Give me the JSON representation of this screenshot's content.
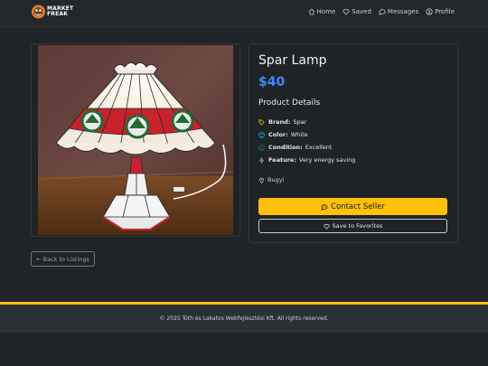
{
  "nav": {
    "logo_text": "MARKET\nFREAK",
    "links": [
      {
        "label": "Home",
        "icon": "home-icon"
      },
      {
        "label": "Saved",
        "icon": "heart-icon"
      },
      {
        "label": "Messages",
        "icon": "chat-icon"
      },
      {
        "label": "Profile",
        "icon": "user-icon"
      }
    ]
  },
  "product": {
    "title": "Spar Lamp",
    "price": "$40",
    "details_heading": "Product Details",
    "specs": [
      {
        "key": "Brand:",
        "value": "Spar",
        "icon": "tag-icon",
        "color": "#ffc107"
      },
      {
        "key": "Color:",
        "value": "White",
        "icon": "palette-icon",
        "color": "#0dcaf0"
      },
      {
        "key": "Condition:",
        "value": "Excellent",
        "icon": "check-circle-icon",
        "color": "#198754"
      },
      {
        "key": "Feature:",
        "value": "Very energy saving",
        "icon": "lightning-icon",
        "color": "#adb5bd"
      }
    ],
    "location": "Bugyi",
    "contact_label": "Contact Seller",
    "favorite_label": "Save to Favorites"
  },
  "back_label": "← Back to Listings",
  "footer_text": "© 2025 Tóth és Lakatos Webfejlesztési Kft. All rights reserved.",
  "colors": {
    "accent": "#ffc107",
    "price": "#3d8bfd",
    "background": "#202428"
  }
}
